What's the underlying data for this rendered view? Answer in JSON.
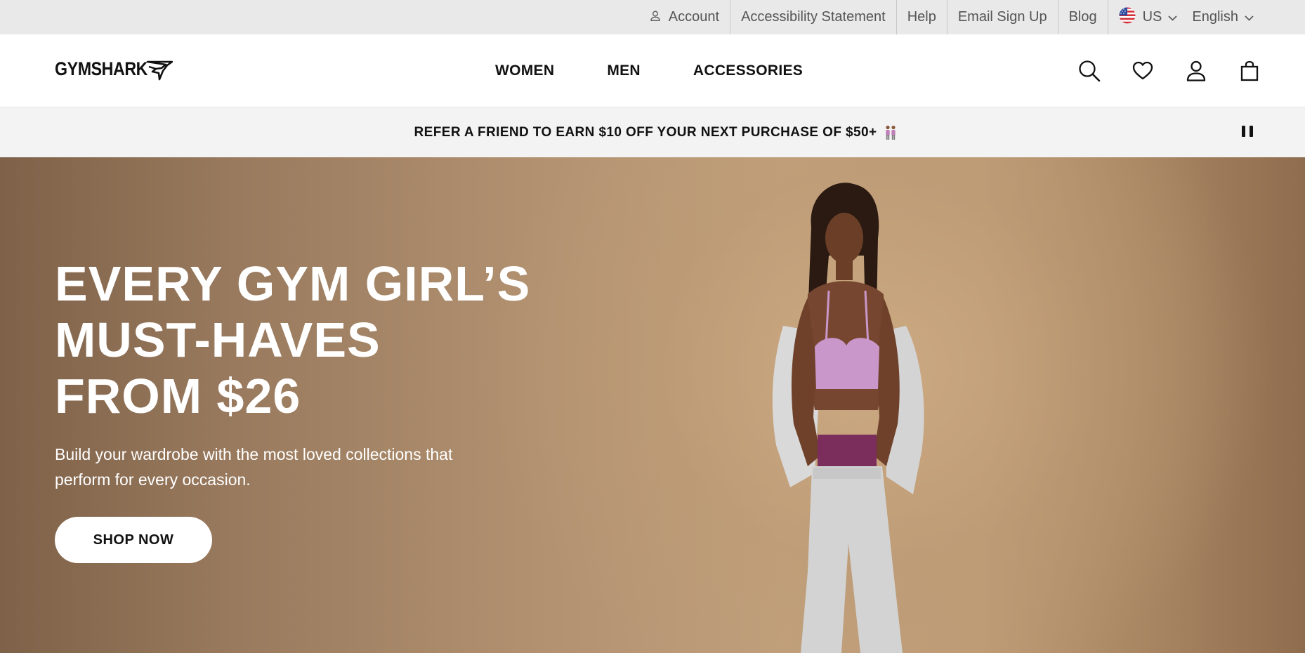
{
  "utility_bar": {
    "account": "Account",
    "accessibility": "Accessibility Statement",
    "help": "Help",
    "email_signup": "Email Sign Up",
    "blog": "Blog",
    "region": "US",
    "language": "English"
  },
  "header": {
    "logo_text": "GYMSHARK",
    "nav": [
      "WOMEN",
      "MEN",
      "ACCESSORIES"
    ],
    "icons": [
      "search-icon",
      "heart-icon",
      "account-icon",
      "bag-icon"
    ]
  },
  "promo": {
    "text": "REFER A FRIEND TO EARN $10 OFF YOUR NEXT PURCHASE OF $50+"
  },
  "hero": {
    "title_lines": [
      "EVERY GYM GIRL’S",
      "MUST-HAVES",
      "FROM $26"
    ],
    "subtitle": "Build your wardrobe with the most loved collections that perform for every occasion.",
    "cta": "SHOP NOW"
  },
  "colors": {
    "utility_bg": "#e9e9e9",
    "promo_bg": "#f3f3f3",
    "hero_bg": "#b0906f",
    "text_dark": "#111111"
  }
}
